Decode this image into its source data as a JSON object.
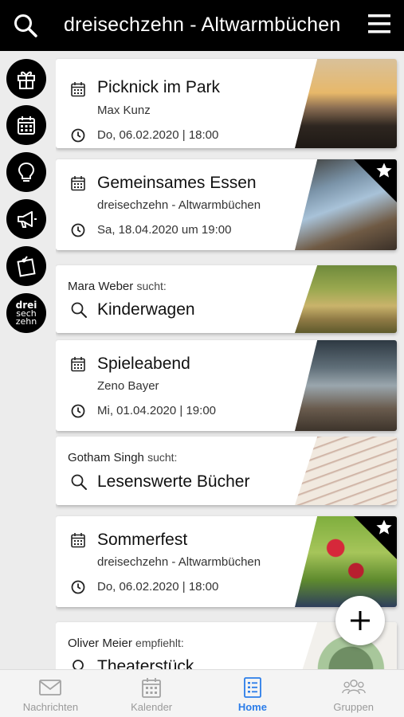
{
  "header": {
    "title": "dreisechzehn - Altwarmbüchen",
    "search_icon": "search-icon",
    "menu_icon": "hamburger-menu-icon"
  },
  "rail": {
    "items": [
      {
        "icon": "gift-icon"
      },
      {
        "icon": "calendar-icon"
      },
      {
        "icon": "lightbulb-icon"
      },
      {
        "icon": "megaphone-icon"
      },
      {
        "icon": "note-pin-icon"
      },
      {
        "icon": "dreisechzehn-logo",
        "logo_lines": [
          "drei",
          "sech",
          "zehn"
        ]
      }
    ]
  },
  "feed": {
    "cards": [
      {
        "type": "event",
        "title": "Picknick im Park",
        "subtitle": "Max Kunz",
        "date": "Do, 06.02.2020 | 18:00",
        "featured": false
      },
      {
        "type": "event",
        "title": "Gemeinsames Essen",
        "subtitle": "dreisechzehn - Altwarmbüchen",
        "date": "Sa, 18.04.2020 um 19:00",
        "featured": true
      },
      {
        "type": "search",
        "person": "Mara Weber",
        "verb": "sucht:",
        "title": "Kinderwagen"
      },
      {
        "type": "event",
        "title": "Spieleabend",
        "subtitle": "Zeno Bayer",
        "date": "Mi, 01.04.2020 | 19:00",
        "featured": false
      },
      {
        "type": "search",
        "person": "Gotham Singh",
        "verb": "sucht:",
        "title": "Lesenswerte Bücher"
      },
      {
        "type": "event",
        "title": "Sommerfest",
        "subtitle": "dreisechzehn - Altwarmbüchen",
        "date": "Do, 06.02.2020 | 18:00",
        "featured": true
      },
      {
        "type": "recommend",
        "person": "Oliver Meier",
        "verb": "empfiehlt:",
        "title": "Theaterstück"
      }
    ]
  },
  "fab": {
    "icon": "plus-icon"
  },
  "bottom_nav": {
    "items": [
      {
        "label": "Nachrichten",
        "icon": "envelope-icon",
        "active": false
      },
      {
        "label": "Kalender",
        "icon": "calendar-icon",
        "active": false
      },
      {
        "label": "Home",
        "icon": "list-icon",
        "active": true
      },
      {
        "label": "Gruppen",
        "icon": "group-icon",
        "active": false
      }
    ],
    "active_color": "#2b7de9",
    "inactive_color": "#9a9a9a"
  }
}
